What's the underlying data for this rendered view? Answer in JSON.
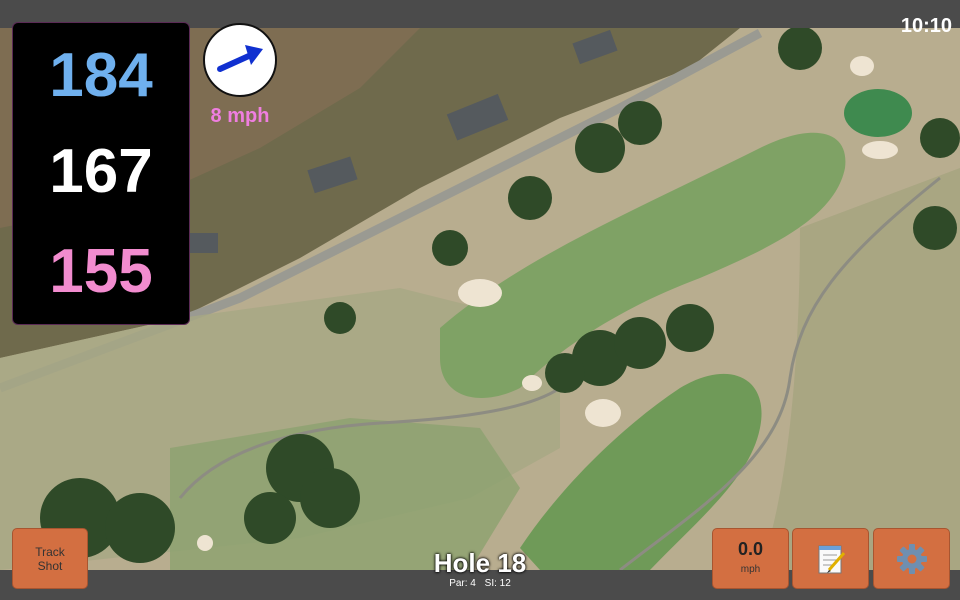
{
  "status": {
    "time": "10:10"
  },
  "distances": {
    "back": "184",
    "middle": "167",
    "front": "155"
  },
  "wind": {
    "speed": "8 mph",
    "direction_icon": "wind-arrow-icon"
  },
  "buttons": {
    "track_shot_line1": "Track",
    "track_shot_line2": "Shot",
    "speed_value": "0.0",
    "speed_unit": "mph",
    "notes_icon": "notepad-icon",
    "settings_icon": "gear-icon"
  },
  "hole": {
    "title": "Hole 18",
    "par": "Par: 4",
    "si": "SI: 12"
  },
  "colors": {
    "back_distance": "#6fb0ee",
    "middle_distance": "#ffffff",
    "front_distance": "#f28ccf",
    "wind_text": "#ef7ee0",
    "button_orange": "#d36f41",
    "bar_gray": "#4b4b4b"
  }
}
